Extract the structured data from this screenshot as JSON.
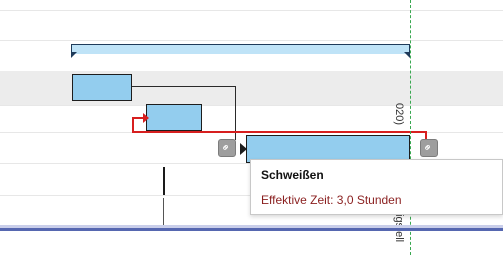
{
  "timeline": {
    "vertical_label_top": "020)",
    "vertical_label_bottom": "igstell"
  },
  "tooltip": {
    "title": "Schweißen",
    "detail": "Effektive Zeit: 3,0 Stunden"
  },
  "colors": {
    "task_fill": "#93cdee",
    "critical_path": "#d71f1f",
    "today_marker": "#39a850",
    "baseline": "#5667b0"
  },
  "icons": {
    "link": "link-icon"
  }
}
